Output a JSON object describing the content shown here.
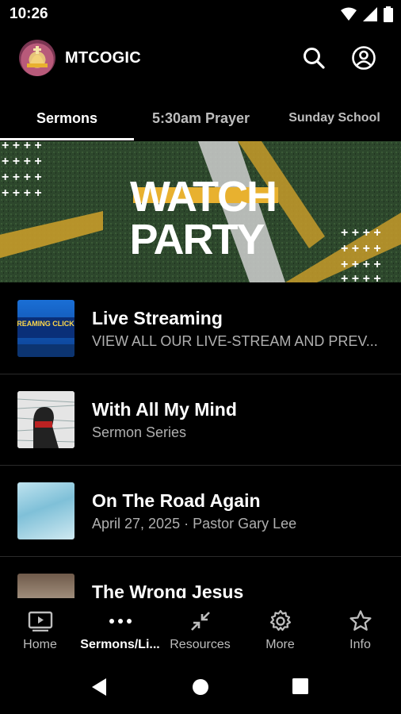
{
  "status_bar": {
    "time": "10:26"
  },
  "app_bar": {
    "title": "MTCOGIC"
  },
  "tabs": [
    {
      "label": "Sermons",
      "active": true
    },
    {
      "label": "5:30am Prayer",
      "active": false
    },
    {
      "label": "Sunday School",
      "active": false
    }
  ],
  "banner": {
    "line1": "WATCH",
    "line2": "PARTY"
  },
  "list": [
    {
      "title": "Live Streaming",
      "subtitle": "VIEW ALL OUR LIVE-STREAM AND PREV...",
      "thumb_icon": "live-streaming-thumbnail",
      "thumb_text": "E-STREAMING CLICK HER"
    },
    {
      "title": "With All My Mind",
      "subtitle": "Sermon Series",
      "thumb_icon": "sermon-series-thumbnail"
    },
    {
      "title": "On The Road Again",
      "subtitle": "April 27, 2025 · Pastor Gary Lee",
      "thumb_icon": "sky-thumbnail"
    },
    {
      "title": "The Wrong Jesus",
      "subtitle": "",
      "thumb_icon": "landscape-thumbnail"
    }
  ],
  "bottom_nav": [
    {
      "label": "Home",
      "icon": "play-screen-icon",
      "active": false
    },
    {
      "label": "Sermons/Li...",
      "icon": "more-dots-icon",
      "active": true
    },
    {
      "label": "Resources",
      "icon": "collapse-arrows-icon",
      "active": false
    },
    {
      "label": "More",
      "icon": "gear-icon",
      "active": false
    },
    {
      "label": "Info",
      "icon": "star-icon",
      "active": false
    }
  ],
  "colors": {
    "background": "#000000",
    "accent_gold": "#e8b12f",
    "turf_green": "#2f4a2c"
  }
}
